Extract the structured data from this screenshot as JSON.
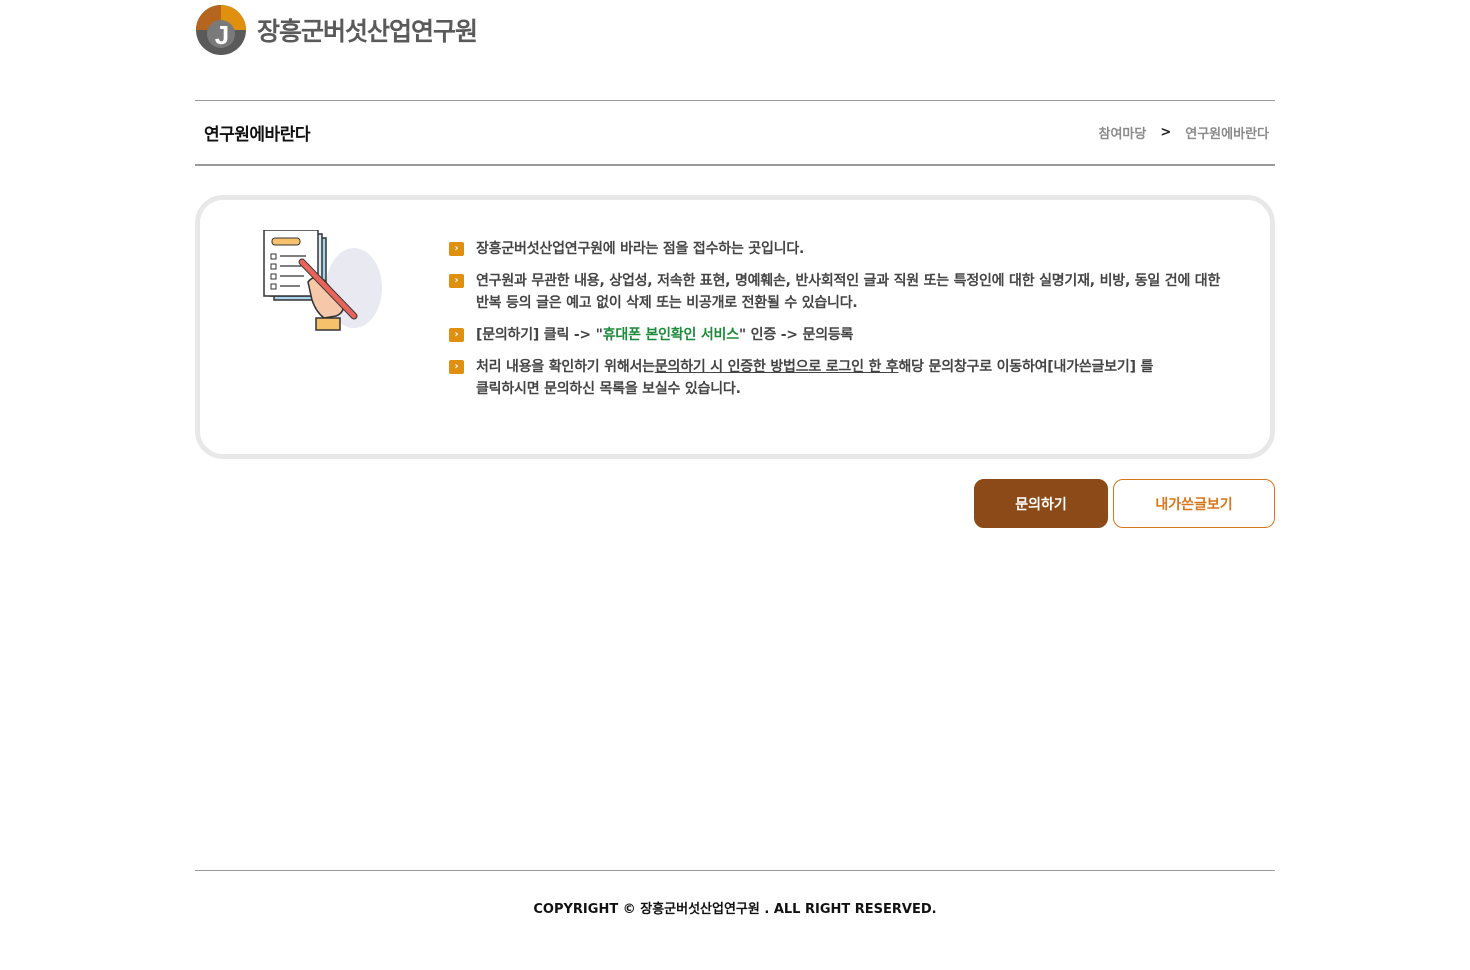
{
  "header": {
    "logo_letter": "J",
    "logo_text": "장흥군버섯산업연구원"
  },
  "page": {
    "title": "연구원에바란다",
    "breadcrumb": [
      "참여마당",
      ">",
      "연구원에바란다"
    ]
  },
  "notice": {
    "items": [
      {
        "text": "장흥군버섯산업연구원에 바라는 점을 접수하는 곳입니다."
      },
      {
        "line1": "연구원과 무관한 내용, 상업성, 저속한 표현, 명예훼손, 반사회적인 글과 직원 또는 특정인에 대한 실명기재, 비방, 동일 건에 대한",
        "line2": "반복 등의 글은 예고 없이 삭제 또는 비공개로 전환될 수 있습니다."
      },
      {
        "before": "[문의하기] 클릭 -> \"",
        "highlight": "휴대폰 본인확인 서비스",
        "after": "\" 인증 -> 문의등록"
      },
      {
        "before": "처리 내용을 확인하기 위해서는",
        "underline": "문의하기 시 인증한 방법으로 로그인 한 후",
        "after": "해당 문의창구로 이동하여[내가쓴글보기] 를",
        "line2": "클릭하시면 문의하신 목록을 보실수 있습니다."
      }
    ],
    "bullet_icon": "chevron-right-icon",
    "accent_color": "#e0900f"
  },
  "buttons": {
    "inquiry": "문의하기",
    "my_posts": "내가쓴글보기"
  },
  "footer": {
    "copyright": "COPYRIGHT © 장흥군버섯산업연구원 . ALL RIGHT RESERVED."
  },
  "colors": {
    "primary_button": "#8b4a17",
    "secondary_text": "#d9751a",
    "highlight_green": "#1d8a3a"
  }
}
